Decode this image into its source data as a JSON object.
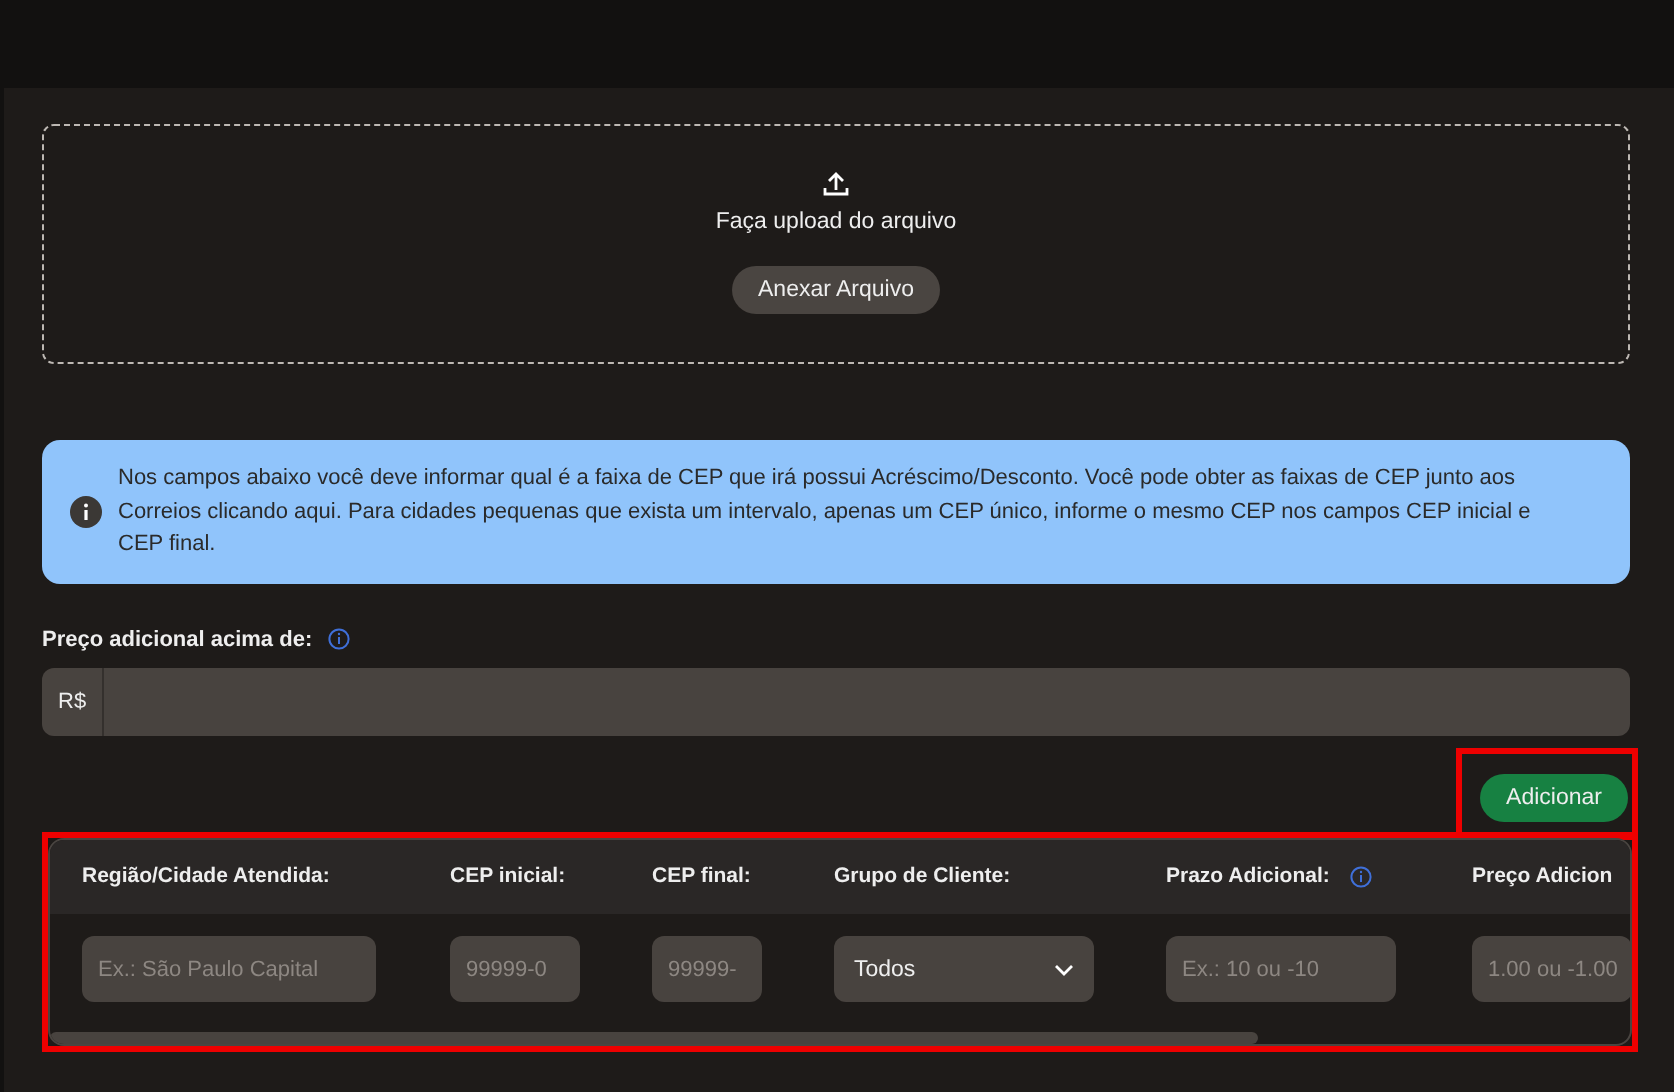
{
  "upload": {
    "title": "Faça upload do arquivo",
    "button": "Anexar Arquivo"
  },
  "info": {
    "text": "Nos campos abaixo você deve informar qual é a faixa de CEP que irá possui Acréscimo/Desconto. Você pode obter as faixas de CEP junto aos Correios clicando aqui. Para cidades pequenas que exista um intervalo, apenas um CEP único, informe o mesmo CEP nos campos CEP inicial e CEP final."
  },
  "price_field": {
    "label": "Preço adicional acima de:",
    "prefix": "R$"
  },
  "add_button": {
    "label": "Adicionar",
    "highlighted": true
  },
  "table": {
    "highlighted": true,
    "columns": [
      {
        "label": "Região/Cidade Atendida:",
        "info": false,
        "kind": "input",
        "placeholder": "Ex.: São Paulo Capital"
      },
      {
        "label": "CEP inicial:",
        "info": false,
        "kind": "input",
        "placeholder": "99999-0"
      },
      {
        "label": "CEP final:",
        "info": false,
        "kind": "input",
        "placeholder": "99999-"
      },
      {
        "label": "Grupo de Cliente:",
        "info": false,
        "kind": "select",
        "value": "Todos"
      },
      {
        "label": "Prazo Adicional:",
        "info": true,
        "kind": "input",
        "placeholder": "Ex.: 10 ou -10"
      },
      {
        "label": "Preço Adicion",
        "kind": "input",
        "placeholder": "1.00 ou -1.00"
      }
    ]
  }
}
